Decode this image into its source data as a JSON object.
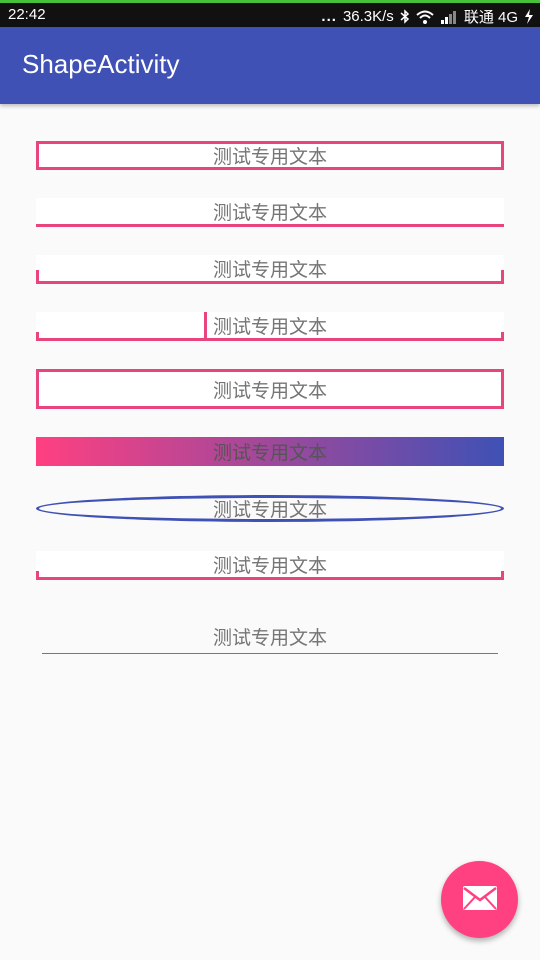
{
  "status_bar": {
    "time": "22:42",
    "dots": "...",
    "speed": "36.3K/s",
    "carrier": "联通 4G",
    "icons": [
      "bluetooth-icon",
      "wifi-icon",
      "signal-icon",
      "charging-icon"
    ]
  },
  "app_bar": {
    "title": "ShapeActivity",
    "color": "#3f51b5"
  },
  "shapes": [
    {
      "label": "测试专用文本",
      "style": "full-border"
    },
    {
      "label": "测试专用文本",
      "style": "bottom-border"
    },
    {
      "label": "测试专用文本",
      "style": "bottom-border-tall-ticks"
    },
    {
      "label": "测试专用文本",
      "style": "bottom-border-short-ticks-with-cursor"
    },
    {
      "label": "测试专用文本",
      "style": "full-border-tall"
    },
    {
      "label": "测试专用文本",
      "style": "gradient",
      "colors": [
        "#ff4081",
        "#3f51b5"
      ]
    },
    {
      "label": "测试专用文本",
      "style": "oval",
      "color": "#3f51b5"
    },
    {
      "label": "测试专用文本",
      "style": "bottom-border-short-ticks"
    }
  ],
  "edit_text": {
    "value": "测试专用文本"
  },
  "fab": {
    "icon": "mail-icon",
    "color": "#ff4081"
  },
  "colors": {
    "accent": "#e8457e",
    "primary": "#3f51b5"
  }
}
